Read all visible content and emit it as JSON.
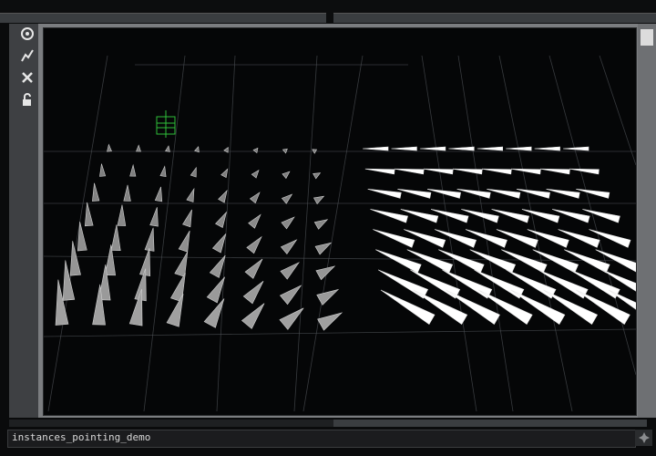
{
  "window": {
    "name": "instances_pointing_demo"
  },
  "toolbar": {
    "tools": [
      {
        "icon": "home-icon"
      },
      {
        "icon": "lightning-icon"
      },
      {
        "icon": "close-icon"
      },
      {
        "icon": "lock-icon"
      }
    ]
  },
  "status": {
    "expand_icon": "expand-icon"
  },
  "colors": {
    "background": "#050607",
    "grid": "#4d5155",
    "gray_cones": "#9a9a9a",
    "white_cones": "#ffffff",
    "gizmo": "#2fbf3a"
  }
}
